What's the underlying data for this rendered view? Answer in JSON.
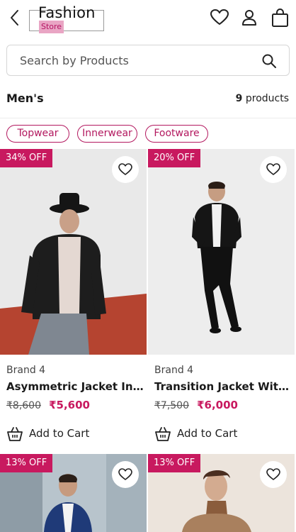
{
  "header": {
    "brand_title": "Fashion",
    "brand_subtitle": "Store",
    "icons": [
      "back-arrow-icon",
      "heart-icon",
      "user-icon",
      "shopping-bag-icon"
    ]
  },
  "search": {
    "placeholder": "Search by Products"
  },
  "section": {
    "title": "Men's",
    "count_number": "9",
    "count_label": "products"
  },
  "filters": [
    "Topwear",
    "Innerwear",
    "Footware"
  ],
  "products": [
    {
      "badge": "34% OFF",
      "brand": "Brand 4",
      "name": "Asymmetric Jacket In Bl...",
      "mrp": "₹8,600",
      "price": "₹5,600",
      "cart_label": "Add to Cart"
    },
    {
      "badge": "20% OFF",
      "brand": "Brand 4",
      "name": "Transition Jacket With H...",
      "mrp": "₹7,500",
      "price": "₹6,000",
      "cart_label": "Add to Cart"
    },
    {
      "badge": "13% OFF"
    },
    {
      "badge": "13% OFF"
    }
  ],
  "colors": {
    "accent": "#c8195f",
    "chip_border": "#b3185f",
    "logo_highlight": "#e9a5c4"
  }
}
